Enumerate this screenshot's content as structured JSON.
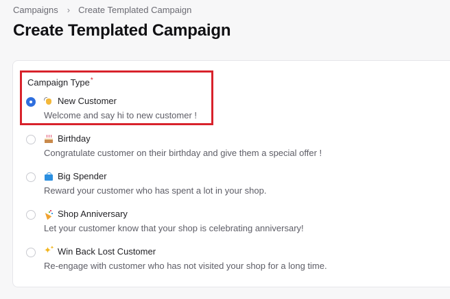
{
  "breadcrumb": {
    "items": [
      "Campaigns",
      "Create Templated Campaign"
    ]
  },
  "page": {
    "title": "Create Templated Campaign"
  },
  "form": {
    "field_label": "Campaign Type",
    "required_mark": "*",
    "options": [
      {
        "label": "New Customer",
        "description": "Welcome and say hi to new customer !",
        "icon": "waving-hand-icon",
        "selected": true
      },
      {
        "label": "Birthday",
        "description": "Congratulate customer on their birthday and give them a special offer !",
        "icon": "birthday-cake-icon",
        "selected": false
      },
      {
        "label": "Big Spender",
        "description": "Reward your customer who has spent a lot in your shop.",
        "icon": "shopping-bag-icon",
        "selected": false
      },
      {
        "label": "Shop Anniversary",
        "description": "Let your customer know that your shop is celebrating anniversary!",
        "icon": "party-popper-icon",
        "selected": false
      },
      {
        "label": "Win Back Lost Customer",
        "description": "Re-engage with customer who has not visited your shop for a long time.",
        "icon": "sparkles-icon",
        "selected": false
      }
    ]
  },
  "colors": {
    "accent": "#2f6fde",
    "required": "#d8222b",
    "highlight_border": "#d8222b"
  }
}
